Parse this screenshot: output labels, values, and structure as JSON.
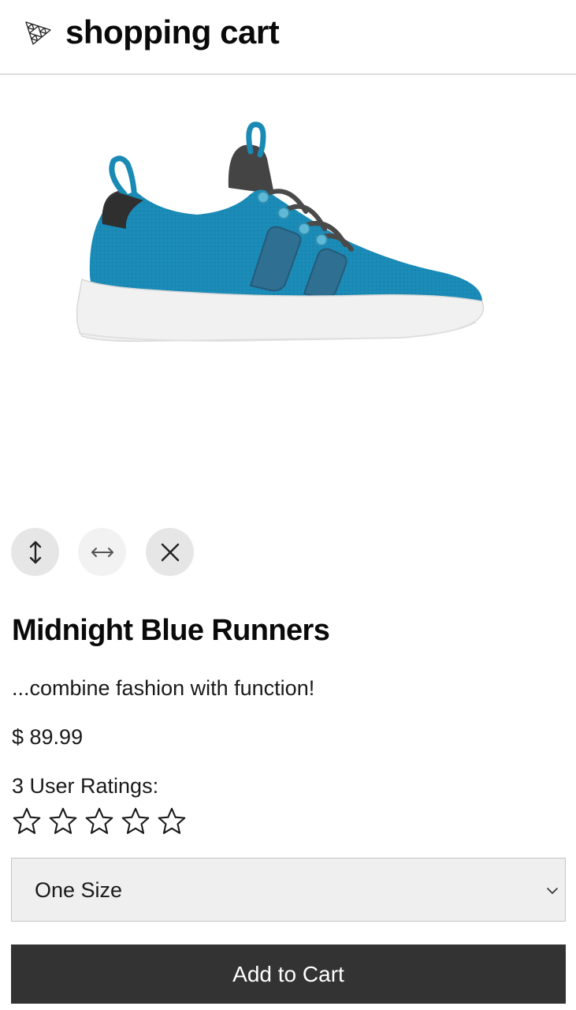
{
  "header": {
    "title": "shopping cart",
    "logo_icon": "triangle-mesh-logo-icon"
  },
  "product": {
    "image_icon": "sneaker-image",
    "name": "Midnight Blue Runners",
    "description": "...combine fashion with function!",
    "price": "$ 89.99",
    "ratings_label": "3 User Ratings:",
    "star_count": 5,
    "rating_filled": 0
  },
  "controls": [
    {
      "icon": "vertical-arrows-icon"
    },
    {
      "icon": "horizontal-arrows-icon"
    },
    {
      "icon": "close-icon"
    }
  ],
  "size_select": {
    "selected": "One Size",
    "icon": "chevron-down-icon"
  },
  "actions": {
    "add_to_cart_label": "Add to Cart"
  },
  "colors": {
    "shoe_blue": "#1a8ab5",
    "button_dark": "#333333",
    "select_bg": "#efefef"
  }
}
